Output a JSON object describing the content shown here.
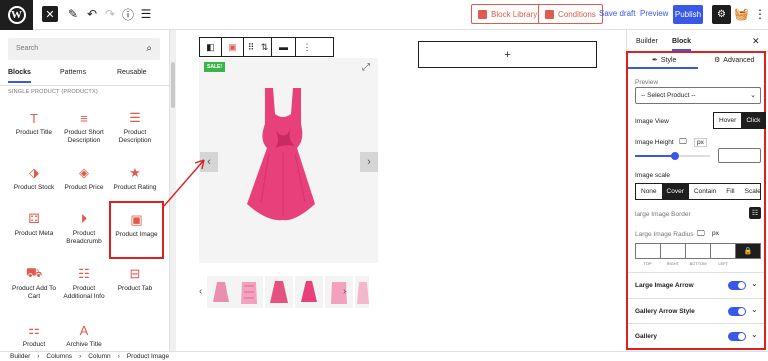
{
  "topbar": {
    "wp_logo": "W",
    "close": "✕",
    "block_library": "Block Library",
    "conditions": "Conditions",
    "save_draft": "Save draft",
    "preview": "Preview",
    "publish": "Publish",
    "accent": "#3858e9",
    "brand_red": "#e05a4d"
  },
  "left_panel": {
    "search_placeholder": "Search",
    "tabs": [
      "Blocks",
      "Patterns",
      "Reusable"
    ],
    "category": "SINGLE PRODUCT (PRODUCTX)",
    "blocks": [
      {
        "label": "Product Title",
        "icon": "T"
      },
      {
        "label": "Product Short Description",
        "icon": "≡"
      },
      {
        "label": "Product Description",
        "icon": "☰"
      },
      {
        "label": "Product Stock",
        "icon": "⬗"
      },
      {
        "label": "Product Price",
        "icon": "◈"
      },
      {
        "label": "Product Rating",
        "icon": "★"
      },
      {
        "label": "Product Meta",
        "icon": "⚃"
      },
      {
        "label": "Product Breadcrumb",
        "icon": "⏵"
      },
      {
        "label": "Product Image",
        "icon": "▣"
      },
      {
        "label": "Product Add To Cart",
        "icon": "⛟"
      },
      {
        "label": "Product Additional Info",
        "icon": "☷"
      },
      {
        "label": "Product Tab",
        "icon": "⊟"
      },
      {
        "label": "Product",
        "icon": "⚏"
      },
      {
        "label": "Archive Title",
        "icon": "A"
      }
    ]
  },
  "canvas": {
    "sale_badge": "SALE!",
    "prev": "‹",
    "next": "›",
    "add_block": "+"
  },
  "right_panel": {
    "tabs": [
      "Builder",
      "Block"
    ],
    "close": "✕",
    "subtabs": [
      "Style",
      "Advanced"
    ],
    "preview_label": "Preview",
    "preview_select": "-- Select Product --",
    "image_view_label": "Image View",
    "image_view_options": [
      "Hover",
      "Click"
    ],
    "image_height_label": "Image Height",
    "unit_px": "px",
    "image_scale_label": "Image scale",
    "image_scale_options": [
      "None",
      "Cover",
      "Contain",
      "Fill",
      "Scale Do"
    ],
    "large_image_border_label": "large Image Border",
    "large_image_radius_label": "Large Image Radius",
    "radius_labels": [
      "TOP",
      "RIGHT",
      "BOTTOM",
      "LEFT"
    ],
    "sections": [
      "Large Image Arrow",
      "Gallery Arrow Style",
      "Gallery"
    ]
  },
  "breadcrumb": [
    "Builder",
    "Columns",
    "Column",
    "Product Image"
  ]
}
